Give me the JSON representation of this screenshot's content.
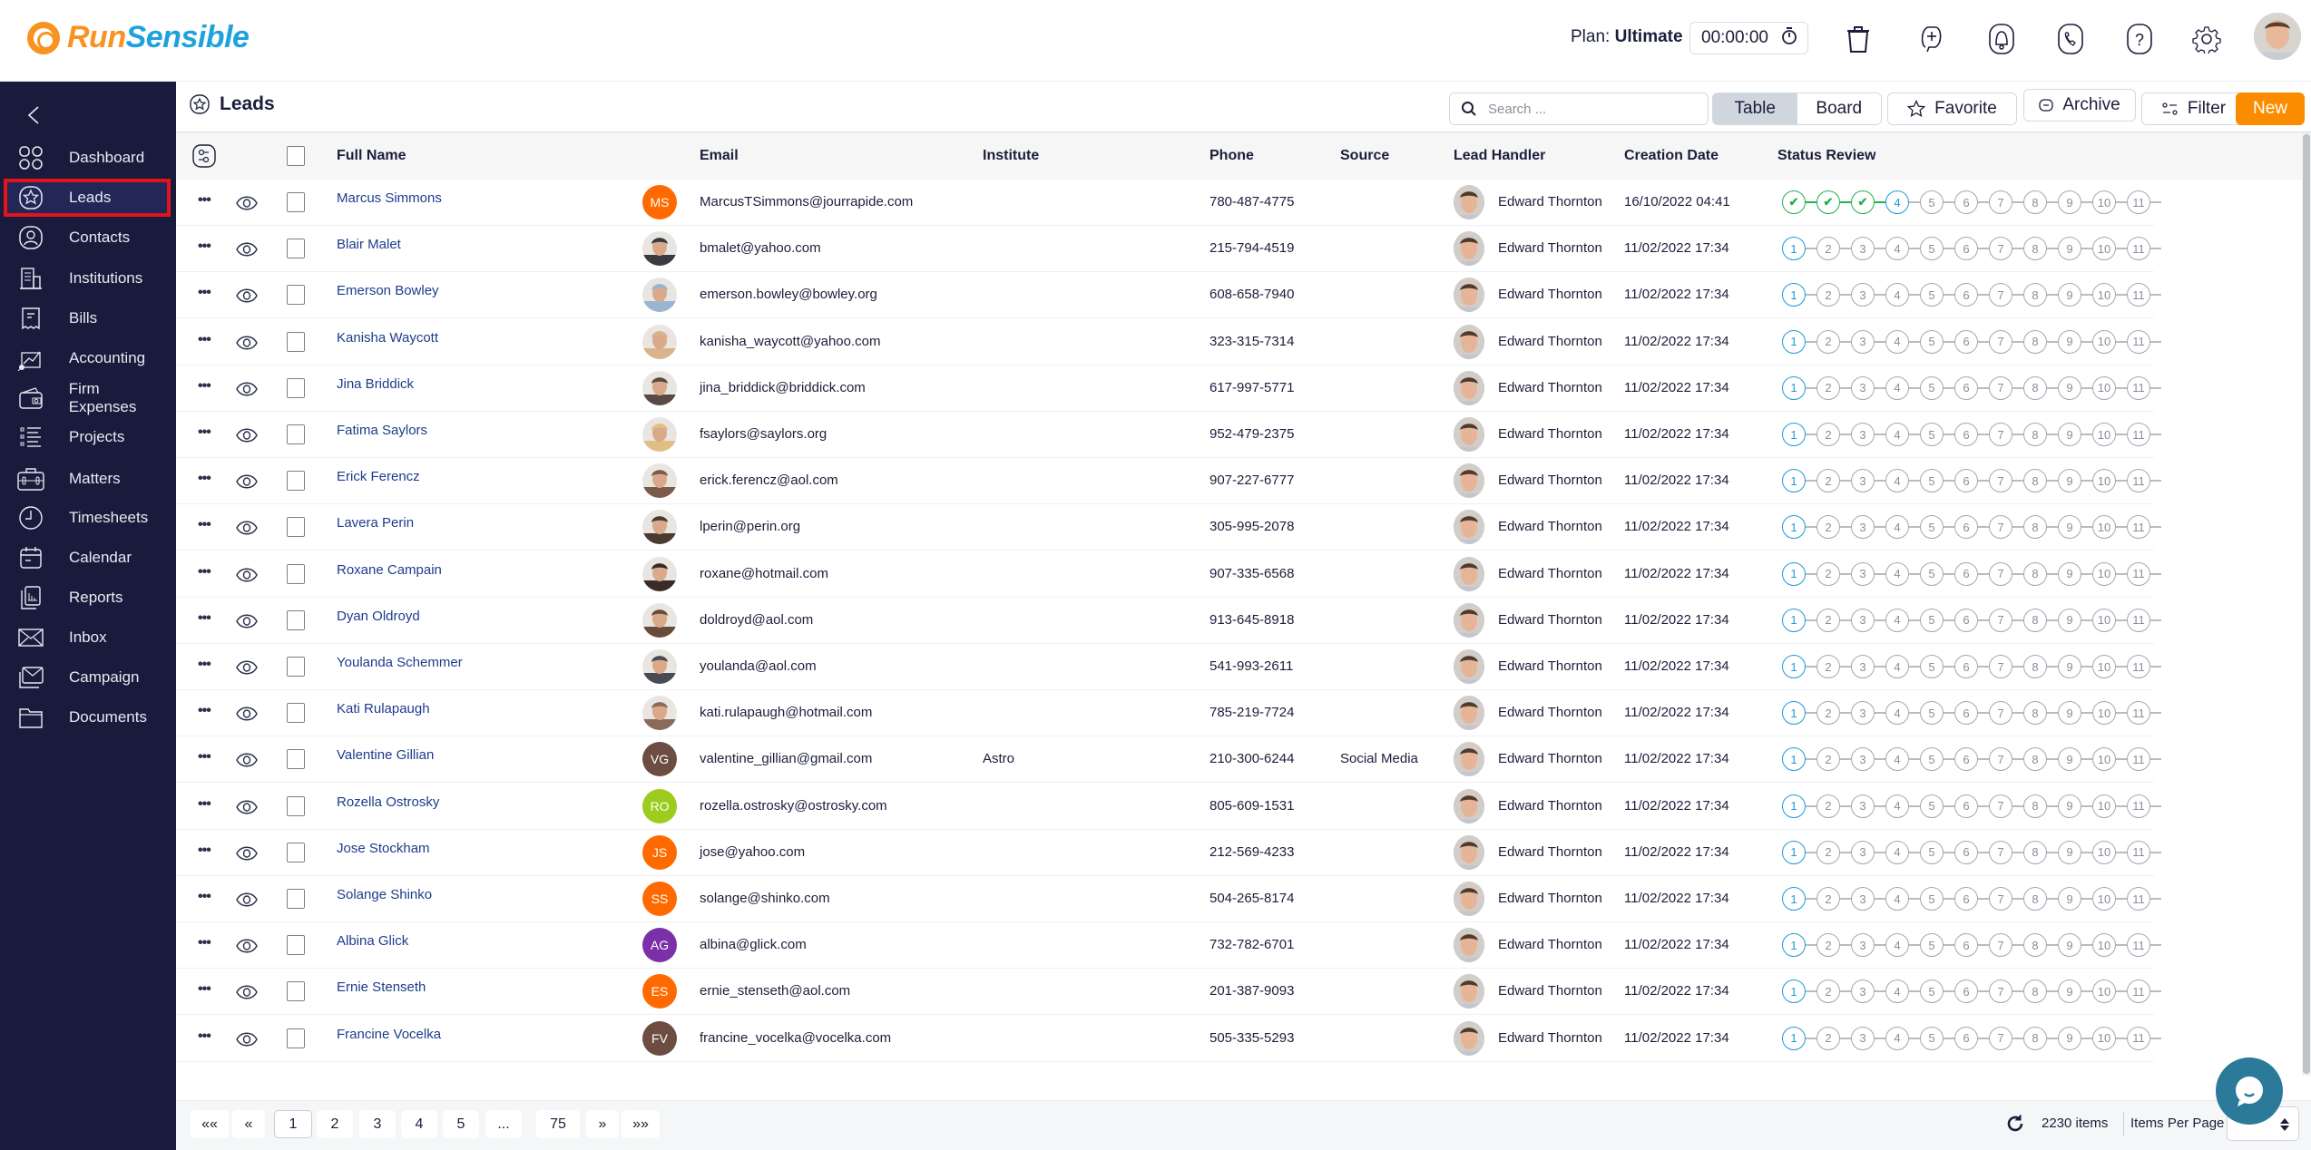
{
  "app": {
    "logo_part1": "Run",
    "logo_part2": "Sensible",
    "plan_label": "Plan:",
    "plan_value": "Ultimate",
    "timer": "00:00:00"
  },
  "topbar_icons": [
    "stopwatch-icon",
    "trash-icon",
    "add-task-icon",
    "bell-icon",
    "phone-icon",
    "help-icon",
    "gear-icon",
    "user-avatar"
  ],
  "sidebar": {
    "items": [
      {
        "label": "Dashboard",
        "icon": "dashboard-icon"
      },
      {
        "label": "Leads",
        "icon": "star-badge-icon",
        "active": true
      },
      {
        "label": "Contacts",
        "icon": "contact-icon"
      },
      {
        "label": "Institutions",
        "icon": "building-icon"
      },
      {
        "label": "Bills",
        "icon": "receipt-icon"
      },
      {
        "label": "Accounting",
        "icon": "accounting-icon"
      },
      {
        "label": "Firm Expenses",
        "icon": "wallet-icon"
      },
      {
        "label": "Projects",
        "icon": "list-icon"
      },
      {
        "label": "Matters",
        "icon": "briefcase-icon"
      },
      {
        "label": "Timesheets",
        "icon": "clock-icon"
      },
      {
        "label": "Calendar",
        "icon": "calendar-icon"
      },
      {
        "label": "Reports",
        "icon": "report-icon"
      },
      {
        "label": "Inbox",
        "icon": "envelope-icon"
      },
      {
        "label": "Campaign",
        "icon": "campaign-icon"
      },
      {
        "label": "Documents",
        "icon": "folder-icon"
      }
    ]
  },
  "page": {
    "title": "Leads",
    "search_placeholder": "Search ...",
    "view_table": "Table",
    "view_board": "Board",
    "active_view": "Table",
    "favorite_label": "Favorite",
    "archive_label": "Archive",
    "filter_label": "Filter",
    "new_label": "New"
  },
  "table": {
    "columns": [
      "Full Name",
      "Email",
      "Institute",
      "Phone",
      "Source",
      "Lead Handler",
      "Creation Date",
      "Status Review"
    ],
    "status_steps": [
      "1",
      "2",
      "3",
      "4",
      "5",
      "6",
      "7",
      "8",
      "9",
      "10",
      "11"
    ],
    "rows": [
      {
        "name": "Marcus Simmons",
        "avatar": "MS",
        "avatar_color": "#ff6a00",
        "email": "MarcusTSimmons@jourrapide.com",
        "institute": "",
        "phone": "780-487-4775",
        "source": "",
        "handler": "Edward Thornton",
        "date": "16/10/2022 04:41",
        "status_step": 4
      },
      {
        "name": "Blair Malet",
        "avatar": "photo",
        "avatar_color": "#3b3a40",
        "email": "bmalet@yahoo.com",
        "institute": "",
        "phone": "215-794-4519",
        "source": "",
        "handler": "Edward Thornton",
        "date": "11/02/2022 17:34",
        "status_step": 1
      },
      {
        "name": "Emerson Bowley",
        "avatar": "photo",
        "avatar_color": "#9bb4d0",
        "email": "emerson.bowley@bowley.org",
        "institute": "",
        "phone": "608-658-7940",
        "source": "",
        "handler": "Edward Thornton",
        "date": "11/02/2022 17:34",
        "status_step": 1
      },
      {
        "name": "Kanisha Waycott",
        "avatar": "photo",
        "avatar_color": "#d9b48a",
        "email": "kanisha_waycott@yahoo.com",
        "institute": "",
        "phone": "323-315-7314",
        "source": "",
        "handler": "Edward Thornton",
        "date": "11/02/2022 17:34",
        "status_step": 1
      },
      {
        "name": "Jina Briddick",
        "avatar": "photo",
        "avatar_color": "#5a4a44",
        "email": "jina_briddick@briddick.com",
        "institute": "",
        "phone": "617-997-5771",
        "source": "",
        "handler": "Edward Thornton",
        "date": "11/02/2022 17:34",
        "status_step": 1
      },
      {
        "name": "Fatima Saylors",
        "avatar": "photo",
        "avatar_color": "#e0bf85",
        "email": "fsaylors@saylors.org",
        "institute": "",
        "phone": "952-479-2375",
        "source": "",
        "handler": "Edward Thornton",
        "date": "11/02/2022 17:34",
        "status_step": 1
      },
      {
        "name": "Erick Ferencz",
        "avatar": "photo",
        "avatar_color": "#7a5a48",
        "email": "erick.ferencz@aol.com",
        "institute": "",
        "phone": "907-227-6777",
        "source": "",
        "handler": "Edward Thornton",
        "date": "11/02/2022 17:34",
        "status_step": 1
      },
      {
        "name": "Lavera Perin",
        "avatar": "photo",
        "avatar_color": "#4a3a30",
        "email": "lperin@perin.org",
        "institute": "",
        "phone": "305-995-2078",
        "source": "",
        "handler": "Edward Thornton",
        "date": "11/02/2022 17:34",
        "status_step": 1
      },
      {
        "name": "Roxane Campain",
        "avatar": "photo",
        "avatar_color": "#3a2a28",
        "email": "roxane@hotmail.com",
        "institute": "",
        "phone": "907-335-6568",
        "source": "",
        "handler": "Edward Thornton",
        "date": "11/02/2022 17:34",
        "status_step": 1
      },
      {
        "name": "Dyan Oldroyd",
        "avatar": "photo",
        "avatar_color": "#6a4a3a",
        "email": "doldroyd@aol.com",
        "institute": "",
        "phone": "913-645-8918",
        "source": "",
        "handler": "Edward Thornton",
        "date": "11/02/2022 17:34",
        "status_step": 1
      },
      {
        "name": "Youlanda Schemmer",
        "avatar": "photo",
        "avatar_color": "#4a4a52",
        "email": "youlanda@aol.com",
        "institute": "",
        "phone": "541-993-2611",
        "source": "",
        "handler": "Edward Thornton",
        "date": "11/02/2022 17:34",
        "status_step": 1
      },
      {
        "name": "Kati Rulapaugh",
        "avatar": "photo",
        "avatar_color": "#8a6a58",
        "email": "kati.rulapaugh@hotmail.com",
        "institute": "",
        "phone": "785-219-7724",
        "source": "",
        "handler": "Edward Thornton",
        "date": "11/02/2022 17:34",
        "status_step": 1
      },
      {
        "name": "Valentine Gillian",
        "avatar": "VG",
        "avatar_color": "#6d4c41",
        "email": "valentine_gillian@gmail.com",
        "institute": "Astro",
        "phone": "210-300-6244",
        "source": "Social Media",
        "handler": "Edward Thornton",
        "date": "11/02/2022 17:34",
        "status_step": 1
      },
      {
        "name": "Rozella Ostrosky",
        "avatar": "RO",
        "avatar_color": "#9ccc1e",
        "email": "rozella.ostrosky@ostrosky.com",
        "institute": "",
        "phone": "805-609-1531",
        "source": "",
        "handler": "Edward Thornton",
        "date": "11/02/2022 17:34",
        "status_step": 1
      },
      {
        "name": "Jose Stockham",
        "avatar": "JS",
        "avatar_color": "#ff6a00",
        "email": "jose@yahoo.com",
        "institute": "",
        "phone": "212-569-4233",
        "source": "",
        "handler": "Edward Thornton",
        "date": "11/02/2022 17:34",
        "status_step": 1
      },
      {
        "name": "Solange Shinko",
        "avatar": "SS",
        "avatar_color": "#ff6a00",
        "email": "solange@shinko.com",
        "institute": "",
        "phone": "504-265-8174",
        "source": "",
        "handler": "Edward Thornton",
        "date": "11/02/2022 17:34",
        "status_step": 1
      },
      {
        "name": "Albina Glick",
        "avatar": "AG",
        "avatar_color": "#7b2fa8",
        "email": "albina@glick.com",
        "institute": "",
        "phone": "732-782-6701",
        "source": "",
        "handler": "Edward Thornton",
        "date": "11/02/2022 17:34",
        "status_step": 1
      },
      {
        "name": "Ernie Stenseth",
        "avatar": "ES",
        "avatar_color": "#ff6a00",
        "email": "ernie_stenseth@aol.com",
        "institute": "",
        "phone": "201-387-9093",
        "source": "",
        "handler": "Edward Thornton",
        "date": "11/02/2022 17:34",
        "status_step": 1
      },
      {
        "name": "Francine Vocelka",
        "avatar": "FV",
        "avatar_color": "#6d4c41",
        "email": "francine_vocelka@vocelka.com",
        "institute": "",
        "phone": "505-335-5293",
        "source": "",
        "handler": "Edward Thornton",
        "date": "11/02/2022 17:34",
        "status_step": 1
      }
    ]
  },
  "pagination": {
    "first": "««",
    "prev": "«",
    "pages": [
      "1",
      "2",
      "3",
      "4",
      "5",
      "...",
      "75"
    ],
    "current": "1",
    "next": "»",
    "last": "»»",
    "total_items": "2230 items",
    "items_per_page_label": "Items Per Page"
  },
  "colors": {
    "sidebar_bg": "#191b3c",
    "accent_orange": "#fb8c00",
    "link_blue": "#1e3c8c",
    "step_done": "#22b14c",
    "step_current": "#1e9bd8",
    "active_highlight": "#e3131b",
    "chat_bubble": "#2b7a99"
  }
}
